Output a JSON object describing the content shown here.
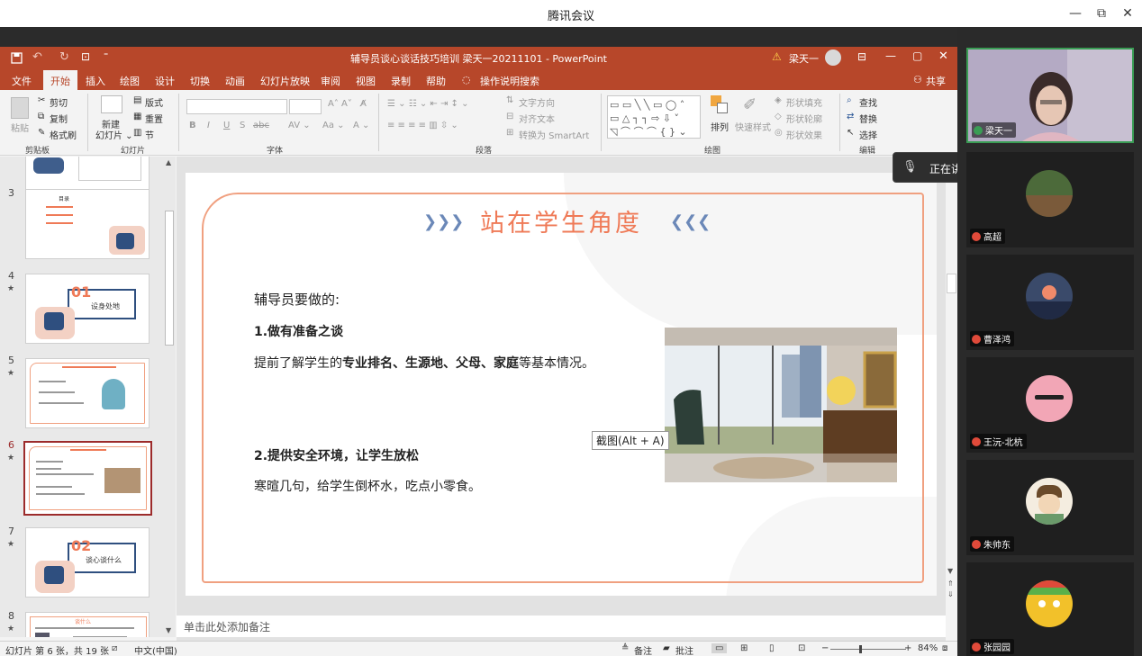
{
  "app": {
    "title": "腾讯会议",
    "minimize": "—",
    "maximize": "⧉",
    "close": "✕"
  },
  "ppt": {
    "window_title": "辅导员谈心谈话技巧培训  梁天一20211101  -  PowerPoint",
    "warning": "⚠",
    "user": "梁天一",
    "tabs": [
      "文件",
      "开始",
      "插入",
      "绘图",
      "设计",
      "切换",
      "动画",
      "幻灯片放映",
      "审阅",
      "视图",
      "录制",
      "帮助",
      "操作说明搜索"
    ],
    "share": "共享",
    "ribbon": {
      "paste": "粘贴",
      "cut": "剪切",
      "copy": "复制",
      "format_painter": "格式刷",
      "clipboard": "剪贴板",
      "new_slide": "新建\n幻灯片",
      "layout": "版式",
      "reset": "重置",
      "section": "节",
      "slides": "幻灯片",
      "font": "字体",
      "text_direction": "文字方向",
      "align_text": "对齐文本",
      "smartart": "转换为 SmartArt",
      "paragraph": "段落",
      "arrange": "排列",
      "quick_styles": "快速样式",
      "shape_fill": "形状填充",
      "shape_outline": "形状轮廓",
      "shape_effects": "形状效果",
      "drawing": "绘图",
      "find": "查找",
      "replace": "替换",
      "select": "选择",
      "editing": "编辑",
      "bold": "B",
      "italic": "I",
      "underline": "U",
      "strike": "S",
      "abc": "abc"
    },
    "thumbnails": [
      {
        "num": "3",
        "star": ""
      },
      {
        "num": "4",
        "star": "★"
      },
      {
        "num": "5",
        "star": "★"
      },
      {
        "num": "6",
        "star": "★"
      },
      {
        "num": "7",
        "star": "★"
      },
      {
        "num": "8",
        "star": "★"
      }
    ],
    "thumb_text": {
      "t3_title": "目录",
      "t4_num": "01",
      "t4_label": "设身处地",
      "t7_num": "02",
      "t7_label": "谈心谈什么",
      "t8_title": "谈什么"
    },
    "slide": {
      "title": "站在学生角度",
      "heading": "辅导员要做的:",
      "point1": "1.做有准备之谈",
      "line1_pre": "提前了解学生的",
      "line1_bold": "专业排名、生源地、父母、家庭",
      "line1_post": "等基本情况。",
      "point2": "2.提供安全环境，让学生放松",
      "line2": "寒暄几句，给学生倒杯水，吃点小零食。",
      "screenshot_tip": "截图(Alt + A)"
    },
    "notes_placeholder": "单击此处添加备注",
    "status": {
      "slide_info": "幻灯片 第 6 张，共 19 张",
      "language": "中文(中国)",
      "notes": "备注",
      "comments": "批注",
      "zoom": "84%"
    }
  },
  "meeting": {
    "speaking": "正在讲话: 梁天一;",
    "participants": [
      {
        "name": "梁天一"
      },
      {
        "name": "高超"
      },
      {
        "name": "曹泽鸿"
      },
      {
        "name": "王沅-北杭"
      },
      {
        "name": "朱帅东"
      },
      {
        "name": "张园园"
      }
    ]
  },
  "colors": {
    "ppt_red": "#b7472a",
    "accent": "#ef7a57",
    "selected_thumb": "#9c2b2b",
    "active_speaker": "#3a9d55"
  }
}
